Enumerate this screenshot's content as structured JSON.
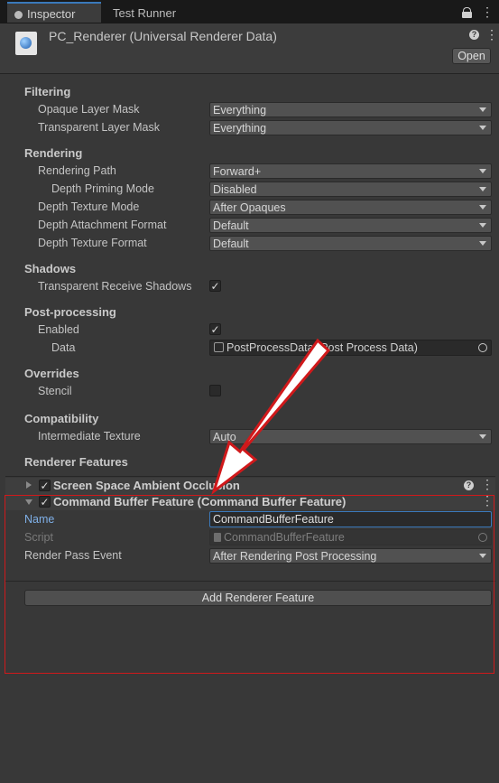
{
  "tabs": {
    "inspector": "Inspector",
    "test_runner": "Test Runner"
  },
  "header": {
    "title": "PC_Renderer (Universal Renderer Data)",
    "open_button": "Open"
  },
  "filtering": {
    "title": "Filtering",
    "opaque_label": "Opaque Layer Mask",
    "opaque_value": "Everything",
    "transparent_label": "Transparent Layer Mask",
    "transparent_value": "Everything"
  },
  "rendering": {
    "title": "Rendering",
    "path_label": "Rendering Path",
    "path_value": "Forward+",
    "priming_label": "Depth Priming Mode",
    "priming_value": "Disabled",
    "depth_tex_mode_label": "Depth Texture Mode",
    "depth_tex_mode_value": "After Opaques",
    "depth_attach_label": "Depth Attachment Format",
    "depth_attach_value": "Default",
    "depth_tex_format_label": "Depth Texture Format",
    "depth_tex_format_value": "Default"
  },
  "shadows": {
    "title": "Shadows",
    "transparent_label": "Transparent Receive Shadows",
    "transparent_checked": true
  },
  "post": {
    "title": "Post-processing",
    "enabled_label": "Enabled",
    "enabled_checked": true,
    "data_label": "Data",
    "data_value": "PostProcessData (Post Process Data)"
  },
  "overrides": {
    "title": "Overrides",
    "stencil_label": "Stencil",
    "stencil_checked": false
  },
  "compat": {
    "title": "Compatibility",
    "intermediate_label": "Intermediate Texture",
    "intermediate_value": "Auto"
  },
  "features": {
    "title": "Renderer Features",
    "ssao": "Screen Space Ambient Occlusion",
    "cmd": "Command Buffer Feature (Command Buffer Feature)",
    "name_label": "Name",
    "name_value": "CommandBufferFeature",
    "script_label": "Script",
    "script_value": "CommandBufferFeature",
    "event_label": "Render Pass Event",
    "event_value": "After Rendering Post Processing",
    "add_button": "Add Renderer Feature"
  },
  "colors": {
    "annotation_red": "#d0191b",
    "accent_blue": "#3a79bb"
  }
}
